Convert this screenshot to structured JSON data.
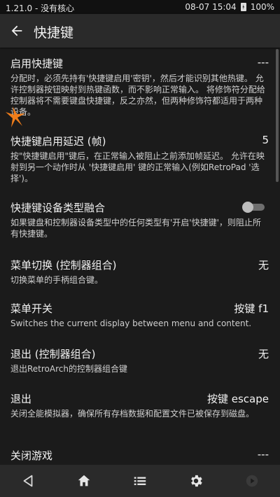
{
  "status_bar": {
    "left_text": "1.21.0 - 没有核心",
    "time": "08-07 15:04",
    "battery": "100%"
  },
  "header": {
    "title": "快捷键"
  },
  "items": [
    {
      "label": "启用快捷键",
      "value": "---",
      "description": "分配时，必须先持有'快捷键启用'密钥'，然后才能识别其他热键。 允许控制器按钮映射到热键函数，而不影响正常输入。 将修饰符分配给控制器将不需要键盘快捷键，反之亦然，但两种修饰符都适用于两种设备。"
    },
    {
      "label": "快捷键启用延迟 (帧)",
      "value": "5",
      "description": "按\"快捷键启用\"键后，在正常输入被阻止之前添加帧延迟。 允许在映射到另一个动作时从 '快捷键启用' 键的正常输入(例如RetroPad '选择')。"
    },
    {
      "label": "快捷键设备类型融合",
      "value": "",
      "toggle_on": false,
      "description": "如果键盘和控制器设备类型中的任何类型有'开启'快捷键'，则阻止所有快捷键。"
    },
    {
      "label": "菜单切换 (控制器组合)",
      "value": "无",
      "description": "切换菜单的手柄组合键。"
    },
    {
      "label": "菜单开关",
      "value": "按键 f1",
      "description": "Switches the current display between menu and content."
    },
    {
      "label": "退出 (控制器组合)",
      "value": "无",
      "description": "退出RetroArch的控制器组合键"
    },
    {
      "label": "退出",
      "value": "按键 escape",
      "description": "关闭全能模拟器，确保所有存档数据和配置文件已被保存到磁盘。"
    },
    {
      "label": "关闭游戏",
      "value": "---",
      "description": ""
    }
  ],
  "icons": {
    "back": "arrow-left-icon",
    "nav_back": "triangle-back-icon",
    "home": "home-icon",
    "list": "list-icon",
    "settings": "gear-icon",
    "play": "play-circle-icon",
    "cursor": "orange-pointer-icon"
  },
  "colors": {
    "accent_cursor": "#f07d1a",
    "background": "#1b1b1b",
    "bar": "#2a2a2a"
  }
}
